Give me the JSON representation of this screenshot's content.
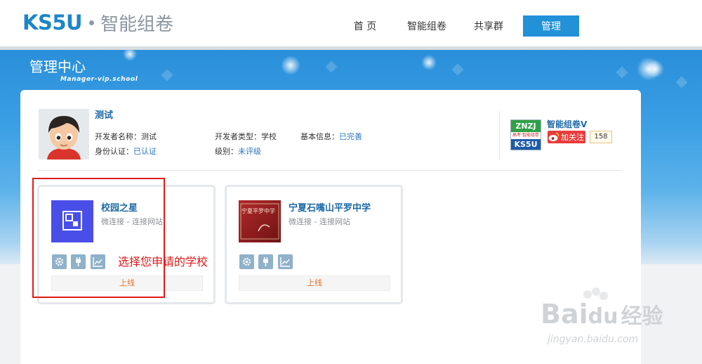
{
  "header": {
    "brand": "KS5U",
    "product": "智能组卷",
    "nav": [
      {
        "label": "首 页"
      },
      {
        "label": "智能组卷"
      },
      {
        "label": "共享群"
      },
      {
        "label": "管理",
        "active": true
      }
    ]
  },
  "banner": {
    "title": "管理中心",
    "subtitle": "Manager-vip.school"
  },
  "profile": {
    "name": "测试",
    "developer_name_label": "开发者名称：",
    "developer_name_value": "测试",
    "developer_type_label": "开发者类型：",
    "developer_type_value": "学校",
    "basic_info_label": "基本信息：",
    "basic_info_value": "已完善",
    "identity_label": "身份认证：",
    "identity_value": "已认证",
    "level_label": "级别：",
    "level_value": "未评级"
  },
  "official_account": {
    "logo_top": "ZNZJ",
    "logo_mid": "高考·智能组卷",
    "logo_bottom": "KS5U",
    "name": "智能组卷V",
    "follow_label": "加关注",
    "follow_count": "158"
  },
  "cards": [
    {
      "title": "校园之星",
      "desc": "微连接 - 连接网站",
      "status_label": "上线",
      "logo_color": "#4a4ee8"
    },
    {
      "title": "宁夏石嘴山平罗中学",
      "desc": "微连接 - 连接网站",
      "status_label": "上线",
      "logo_text": "宁夏平罗中学",
      "logo_color": "#8e1a1e"
    }
  ],
  "annotation": {
    "text": "选择您申请的学校"
  },
  "watermark": {
    "text": "Bai",
    "text2": "du",
    "cn": "经验",
    "url": "jingyan.baidu.com"
  },
  "colors": {
    "accent": "#2291d8",
    "link": "#1f6aa8",
    "annotation": "#e21a1a",
    "online": "#e2742c"
  }
}
